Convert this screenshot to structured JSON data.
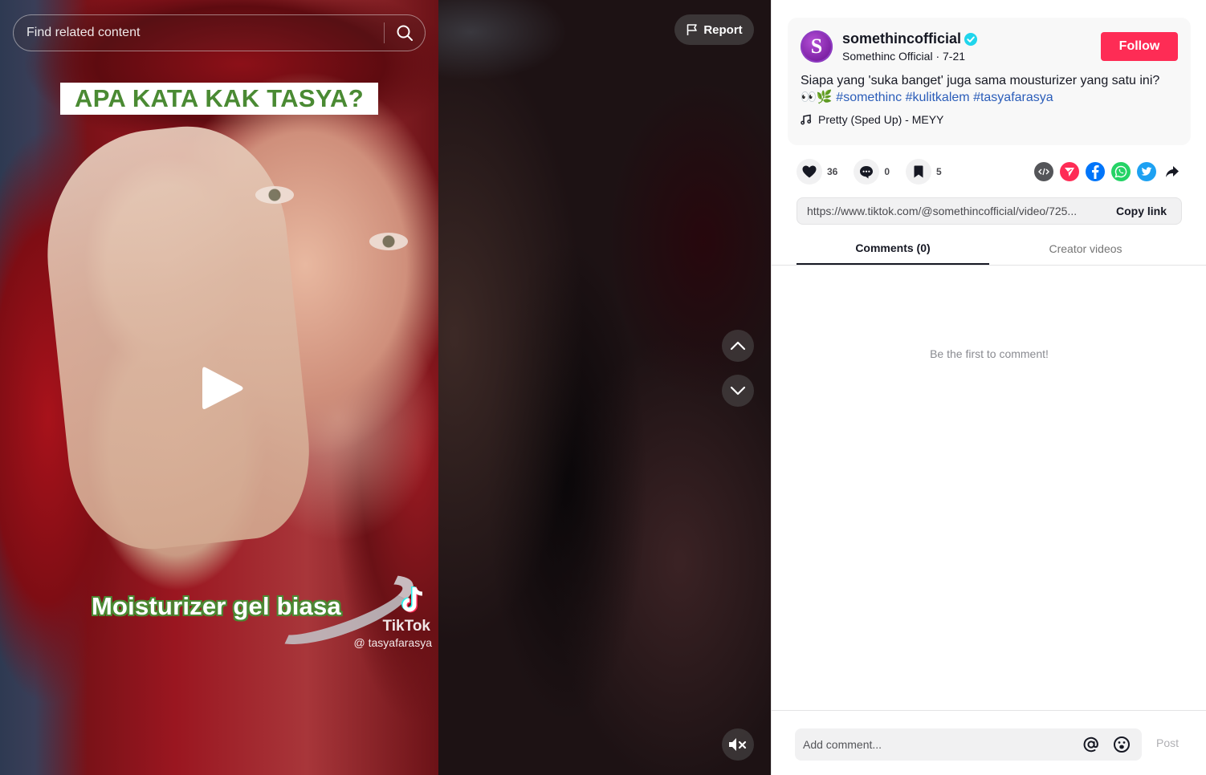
{
  "video": {
    "search": {
      "placeholder": "Find related content"
    },
    "overlay_title": "APA KATA KAK TASYA?",
    "overlay_caption": "Moisturizer gel biasa",
    "watermark": {
      "brand": "TikTok",
      "handle": "@ tasyafarasya"
    },
    "report_label": "Report",
    "icons": {
      "search": "search-icon",
      "play": "play-icon",
      "report": "flag-icon",
      "up": "chevron-up-icon",
      "down": "chevron-down-icon",
      "mute": "speaker-muted-icon"
    }
  },
  "post": {
    "author": {
      "username": "somethincofficial",
      "display_name": "Somethinc Official",
      "date": "7-21",
      "sub_line": "Somethinc Official · 7-21",
      "avatar_letter": "S",
      "verified": true
    },
    "follow_label": "Follow",
    "description": "Siapa yang 'suka banget' juga sama mousturizer yang satu ini?",
    "emoji": "👀🌿",
    "hashtags": [
      "#somethinc",
      "#kulitkalem",
      "#tasyafarasya"
    ],
    "music": "Pretty (Sped Up) - MEYY"
  },
  "actions": {
    "likes": "36",
    "comments": "0",
    "saves": "5",
    "share_targets": [
      "embed",
      "send-to-friends",
      "facebook",
      "whatsapp",
      "twitter",
      "share"
    ]
  },
  "link": {
    "url": "https://www.tiktok.com/@somethincofficial/video/725...",
    "copy_label": "Copy link"
  },
  "tabs": [
    {
      "label": "Comments (0)",
      "active": true
    },
    {
      "label": "Creator videos",
      "active": false
    }
  ],
  "comments": {
    "empty_text": "Be the first to comment!",
    "input_placeholder": "Add comment...",
    "post_label": "Post"
  },
  "colors": {
    "brand_red": "#fe2c55",
    "hashtag_blue": "#2b5db9",
    "overlay_green": "#4a8a33"
  }
}
